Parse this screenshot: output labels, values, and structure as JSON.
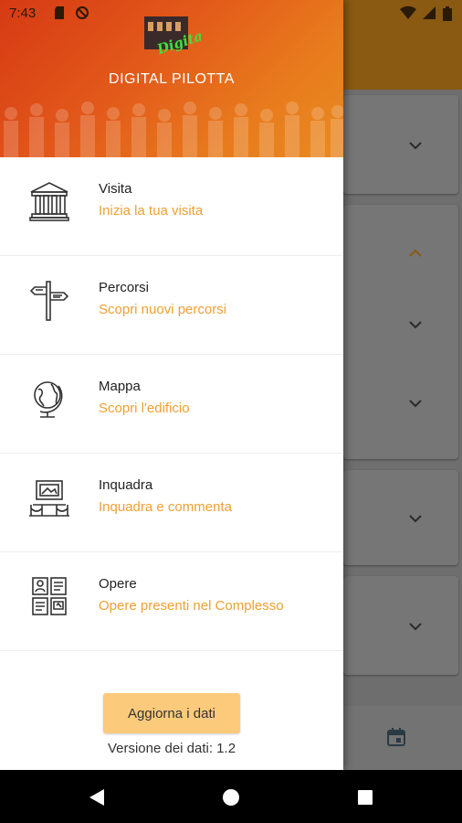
{
  "status_bar": {
    "time": "7:43"
  },
  "drawer": {
    "app_title": "DIGITAL PILOTTA",
    "logo_text": "Digital",
    "menu": [
      {
        "title": "Visita",
        "subtitle": "Inizia la tua visita",
        "icon": "museum-icon"
      },
      {
        "title": "Percorsi",
        "subtitle": "Scopri nuovi percorsi",
        "icon": "signpost-icon"
      },
      {
        "title": "Mappa",
        "subtitle": "Scopri l'edificio",
        "icon": "globe-icon"
      },
      {
        "title": "Inquadra",
        "subtitle": "Inquadra e commenta",
        "icon": "framed-artwork-icon"
      },
      {
        "title": "Opere",
        "subtitle": "Opere presenti nel Complesso",
        "icon": "artworks-gallery-icon"
      }
    ],
    "update_button": "Aggiorna i dati",
    "data_version": "Versione dei dati: 1.2"
  },
  "colors": {
    "accent": "#f0a031",
    "button": "#fcca7b",
    "header_start": "#d63a14",
    "header_end": "#e98a22"
  }
}
